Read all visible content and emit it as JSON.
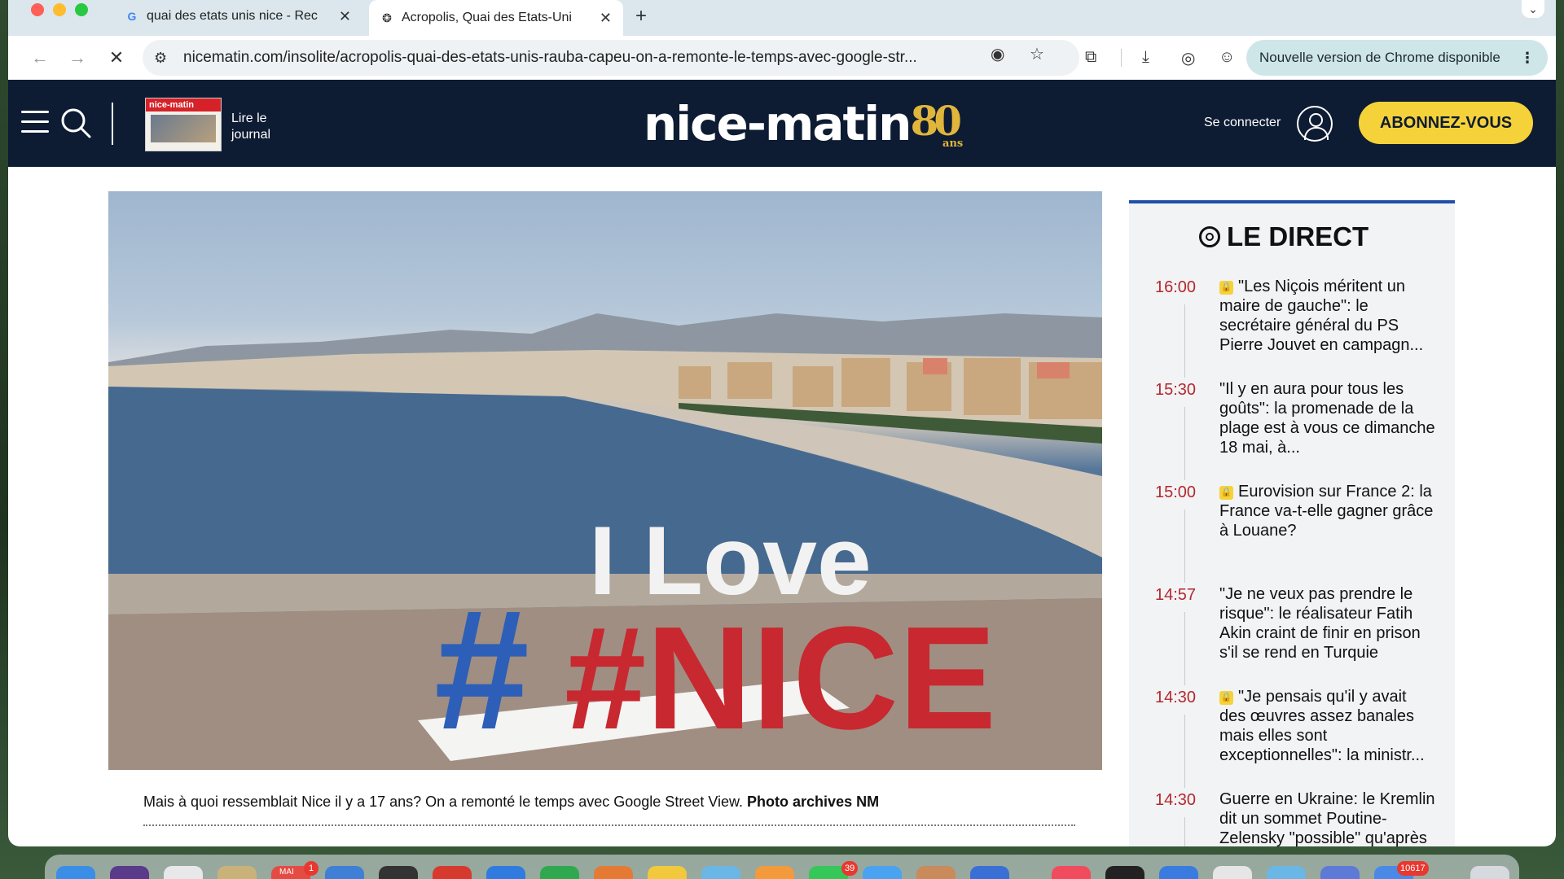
{
  "browser": {
    "tabs": [
      {
        "title": "quai des etats unis nice - Rec",
        "favicon": "G",
        "active": false
      },
      {
        "title": "Acropolis, Quai des Etats-Uni",
        "favicon": "nicematin-icon",
        "active": true
      }
    ],
    "new_tab_label": "+",
    "url": "nicematin.com/insolite/acropolis-quai-des-etats-unis-rauba-capeu-on-a-remonte-le-temps-avec-google-str...",
    "update_label": "Nouvelle version de Chrome disponible"
  },
  "header": {
    "journal_label_line1": "Lire le",
    "journal_label_line2": "journal",
    "journal_thumb_logo": "nice-matin",
    "logo_text": "nice-matin",
    "logo_anniversary": "80",
    "logo_anniversary_suffix": "ans",
    "connect_label": "Se connecter",
    "subscribe_label": "ABONNEZ-VOUS"
  },
  "article": {
    "photo_sign_line1": "I Love",
    "photo_sign_line2": "#NICE",
    "caption_text": "Mais à quoi ressemblait Nice il y a 17 ans? On a remonté le temps avec Google Street View.",
    "caption_credit": "Photo archives NM"
  },
  "live": {
    "title": "LE DIRECT",
    "entries": [
      {
        "time": "16:00",
        "locked": true,
        "text": "\"Les Niçois méritent un maire de gauche\": le secrétaire général du PS Pierre Jouvet en campagn..."
      },
      {
        "time": "15:30",
        "locked": false,
        "text": "\"Il y en aura pour tous les goûts\": la promenade de la plage est à vous ce dimanche 18 mai, à..."
      },
      {
        "time": "15:00",
        "locked": true,
        "text": "Eurovision sur France 2: la France va-t-elle gagner grâce à Louane?"
      },
      {
        "time": "14:57",
        "locked": false,
        "text": "\"Je ne veux pas prendre le risque\": le réalisateur Fatih Akin craint de finir en prison s'il se rend en Turquie"
      },
      {
        "time": "14:30",
        "locked": true,
        "text": "\"Je pensais qu'il y avait des œuvres assez banales mais elles sont exceptionnelles\": la ministr..."
      },
      {
        "time": "14:30",
        "locked": false,
        "text": "Guerre en Ukraine: le Kremlin dit un sommet Poutine-Zelensky \"possible\" qu'après des \"accords\""
      }
    ]
  },
  "dock": {
    "badge_mail": "1",
    "badge_month": "MAI",
    "badge_messages": "39",
    "badge_count": "10617"
  },
  "colors": {
    "header_bg": "#0d1b33",
    "subscribe_bg": "#f6d23a",
    "live_time": "#b3282d",
    "live_accent": "#1f4fa8"
  }
}
